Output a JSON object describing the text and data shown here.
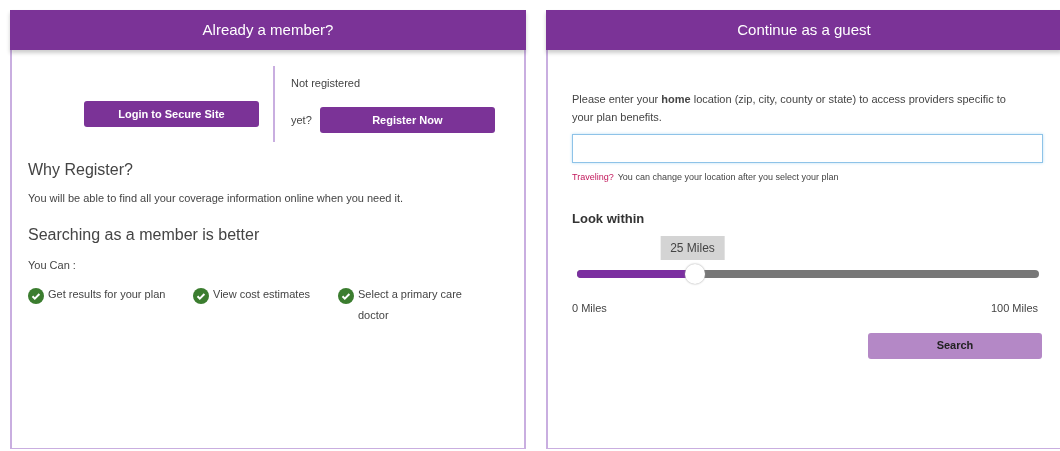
{
  "member_panel": {
    "title": "Already a member?",
    "login_button": "Login to Secure Site",
    "not_registered": "Not registered",
    "yet": "yet?",
    "register_button": "Register Now",
    "why_heading": "Why Register?",
    "why_text": "You will be able to find all your coverage information online when you need it.",
    "better_heading": "Searching as a member is better",
    "you_can": "You Can :",
    "benefits": [
      {
        "text": "Get results for your plan",
        "checked": true
      },
      {
        "text": "View cost estimates",
        "checked": true
      },
      {
        "text": "Select a primary care doctor",
        "checked": true
      }
    ]
  },
  "guest_panel": {
    "title": "Continue as a guest",
    "instructions": "Please enter your **home** location (zip, city, county or state) to access providers specific to your plan benefits.",
    "hint_link": "Traveling?",
    "hint_text": "You can change your location after you select your plan",
    "look_within": "Look within",
    "slider": {
      "level": 0.25,
      "reading": "25 Miles",
      "min_label": "0 Miles",
      "max_label": "100 Miles"
    },
    "search_button": {
      "label": "Search",
      "disabled": true
    }
  }
}
